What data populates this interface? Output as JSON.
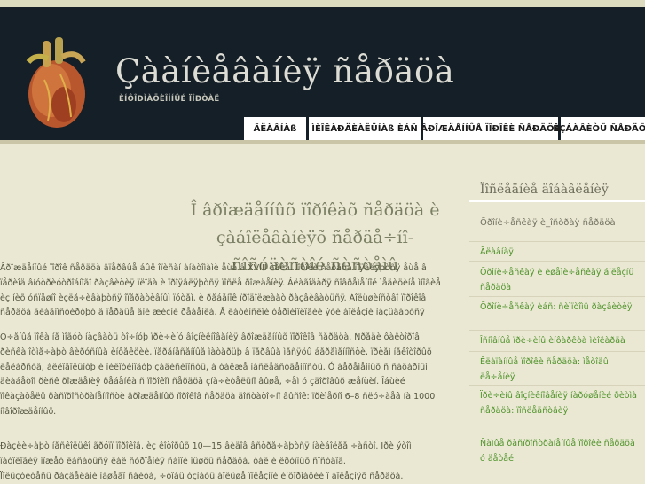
{
  "site": {
    "title": "Çààíèåâàíèÿ ñåðäöà",
    "subtitle": "ÈÍÔÎÐÌÀÖÈÎÍÍÛÉ ÏÎÐÒÀË"
  },
  "nav": [
    {
      "label": "ÃËÀÂÍÀß"
    },
    {
      "label": "ÌÈÎÊÀÐÄÈÀËÜÍÀß ÈÁÑ"
    },
    {
      "label": "ÂÐÎÆÄÅÍÍÛÅ ÏÎÐÎÊÈ ÑÅÐÄÖÀ"
    },
    {
      "label": "ÈÇÁÀÂÈÒÜ ÑÅÐÄÖÀ"
    }
  ],
  "article": {
    "title": "Î âðîæäåííûõ ïîðîêàõ ñåðäöà è çàáîëåâàíèÿõ ñåðäå÷íî-ñîñóäèñòîé ñèñòåìû",
    "paragraphs": [
      "Âðîæäåííûé ïîðîê ñåðäöà âïåðâûå áûë îïèñàí àíàòîìàìè åùå â XVIII âåêå. Ïîðîêè ñåðäöà ïîÿâëÿþòñÿ åùå â ïåðèîä âíóòðèóòðîáíîãî ðàçâèòèÿ ïëîäà è ïðîÿâëÿþòñÿ ïîñëå ðîæäåíèÿ. Áëàãîäàðÿ ñîâðåìåííîé ìåäèöèíå ìíîãèå èç íèõ óñïåøíî èçëå÷èâàþòñÿ îïåðàòèâíûì ïóòåì, è ðåáåíîê ïðîäîëæàåò ðàçâèâàòüñÿ. Áîëüøèíñòâî ïîðîêîâ ñåðäöà äèàãíîñòèðóþò â ïåðâûå äíè æèçíè ðåáåíêà. Â ëàòèíñêîé òåðìèíîëîãèè ýòè áîëåçíè íàçûâàþòñÿ vitium cordis congenitum.",
      "Ó÷åíûå ïîêà íå ìîãóò íàçâàòü òî÷íóþ ïðè÷èíó âîçíèêíîâåíèÿ âðîæäåííûõ ïîðîêîâ ñåðäöà. Ñðåäè ôàêòîðîâ ðèñêà îòìå÷àþò âèðóñíûå èíôåêöèè, ïåðåíåñåííûå ìàòåðüþ â ïåðâûå ìåñÿöû áåðåìåííîñòè, ïðèåì íåêîòîðûõ ëåêàðñòâ, àëêîãîëüíóþ è íèêîòèíîâóþ çàâèñèìîñòü, à òàêæå íàñëåäñòâåííîñòü. Ó áåðåìåííûõ ñ ñàõàðíûì äèàáåòîì ðèñê ðîæäåíèÿ ðåáåíêà ñ ïîðîêîì ñåðäöà çíà÷èòåëüíî âûøå, ÷åì ó çäîðîâûõ æåíùèí. Îáùèé ïîêàçàòåëü ðàñïðîñòðàíåííîñòè âðîæäåííûõ ïîðîêîâ ñåðäöà äîñòàòî÷íî âûñîê: ïðèìåðíî 6–8 ñëó÷àåâ íà 1000 íîâîðîæäåííûõ.",
      "Ðàçëè÷àþò íåñêîëüêî ãðóïï ïîðîêîâ, èç êîòîðûõ 10—15 âèäîâ âñòðå÷àþòñÿ íàèáîëåå ÷àñòî. Ïðè ýòîì ïàòîëîãèÿ ìîæåò êàñàòüñÿ êàê ñòðîåíèÿ ñàìîé ìûøöû ñåðäöà, òàê è êðóïíûõ ñîñóäîâ.",
      "Ïîëüçóéòåñü ðàçäåëàìè íàøåãî ñàéòà, ÷òîáû óçíàòü áîëüøå ïîëåçíîé èíôîðìàöèè î áîëåçíÿõ ñåðäöà."
    ]
  },
  "sidebar": {
    "title": "Ïîñëåäíèå äîáàâëåíèÿ",
    "subtitle": "Õðîíè÷åñêàÿ è_îñòðàÿ ñåðäöà",
    "links": [
      "Ãëàâíàÿ",
      "Õðîíè÷åñêàÿ è èøåìè÷åñêàÿ áîëåçíü ñåðäöà",
      "Õðîíè÷åñêàÿ èáñ: ñèìïòîìû ðàçâèòèÿ",
      "Îñíîâíûå ïðè÷èíû èíôàðêòà ìèîêàðäà",
      "Êëàïàííûå ïîðîêè ñåðäöà: ìåòîäû ëå÷åíèÿ",
      "Ïðè÷èíû âîçíèêíîâåíèÿ íàðóøåíèé ðèòìà ñåðäöà: ïîñëåäñòâèÿ",
      "Ñàìûå ðàñïðîñòðàíåííûå ïîðîêè ñåðäöà ó äåòåé"
    ]
  },
  "colors": {
    "header_bg": "#151f27",
    "page_bg": "#eae8d3",
    "link": "#4f932a"
  }
}
